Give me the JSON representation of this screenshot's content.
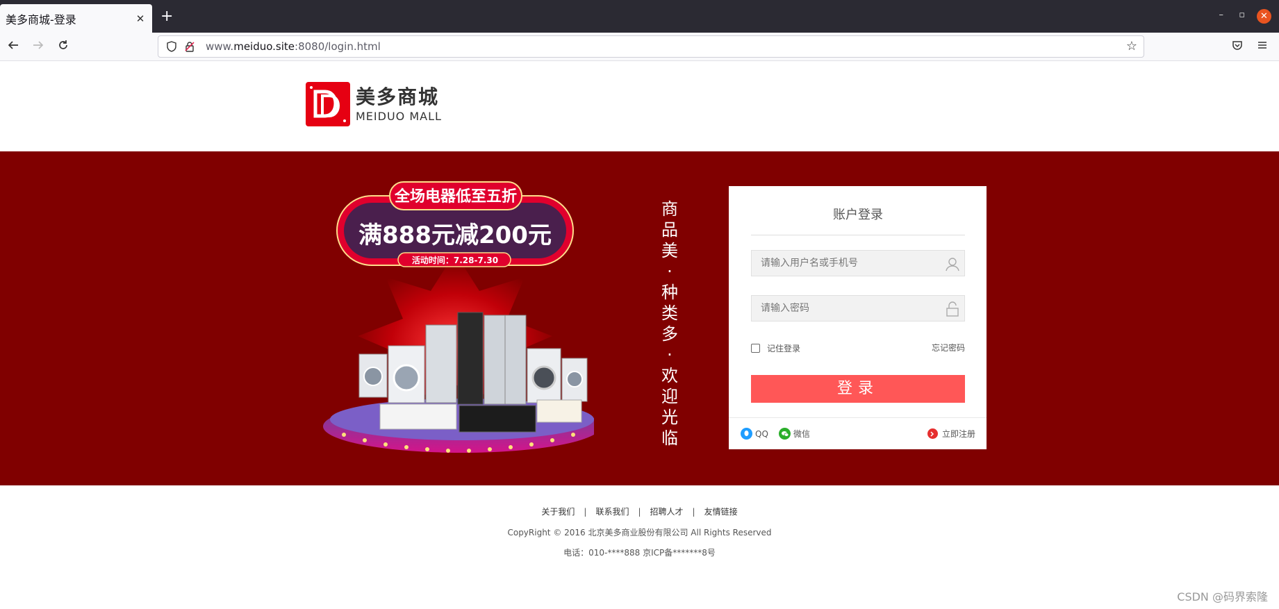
{
  "browser": {
    "tab_title": "美多商城-登录",
    "tab_close": "✕",
    "new_tab": "+",
    "url_scheme_host_prefix": "www.",
    "url_host": "meiduo.site",
    "url_rest": ":8080/login.html",
    "win_min": "–",
    "win_max": "▫",
    "win_close": "✕"
  },
  "header": {
    "logo_cn": "美多商城",
    "logo_en": "MEIDUO MALL"
  },
  "banner": {
    "promo_top": "全场电器低至五折",
    "promo_main": "满888元减200元",
    "promo_time": "活动时间：7.28-7.30",
    "slogan": "商品美·种类多·欢迎光临",
    "bg_color": "#800000"
  },
  "login": {
    "title": "账户登录",
    "username_placeholder": "请输入用户名或手机号",
    "password_placeholder": "请输入密码",
    "remember_label": "记住登录",
    "forgot_label": "忘记密码",
    "submit_label": "登录",
    "qq_label": "QQ",
    "wechat_label": "微信",
    "register_label": "立即注册",
    "accent": "#ff5757"
  },
  "footer": {
    "links": [
      "关于我们",
      "联系我们",
      "招聘人才",
      "友情链接"
    ],
    "separator": "|",
    "copyright": "CopyRight © 2016 北京美多商业股份有限公司 All Rights Reserved",
    "phone": "电话：010-****888 京ICP备*******8号"
  },
  "watermark": "CSDN @码界索隆"
}
